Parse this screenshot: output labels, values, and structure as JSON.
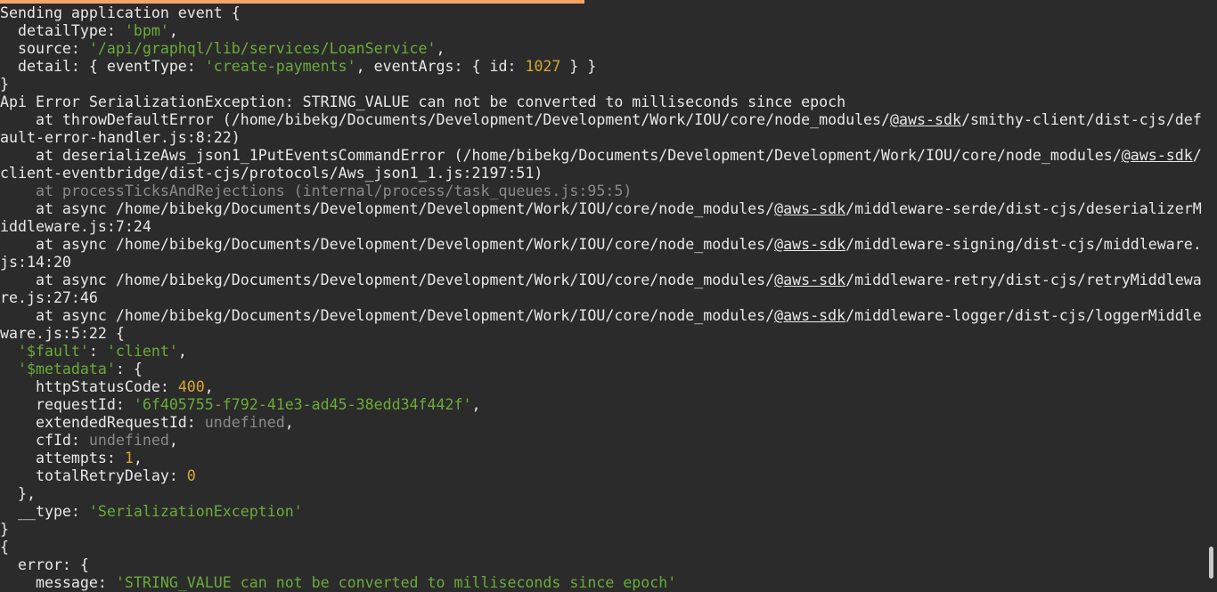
{
  "window": {
    "accent": "#f2a66a",
    "background": "#2b2b2b",
    "text": "#e8e8e8",
    "string_color": "#6aab39",
    "number_color": "#d6a92f",
    "undefined_color": "#8a8a8a"
  },
  "event": {
    "header": "Sending application event {",
    "detailType_key": "  detailType: ",
    "detailType_val": "'bpm'",
    "detailType_end": ",",
    "source_key": "  source: ",
    "source_val": "'/api/graphql/lib/services/LoanService'",
    "source_end": ",",
    "detail_pre": "  detail: { eventType: ",
    "detail_type": "'create-payments'",
    "detail_mid": ", eventArgs: { id: ",
    "detail_id": "1027",
    "detail_end": " } }",
    "close": "}"
  },
  "error": {
    "title": "Api Error SerializationException: STRING_VALUE can not be converted to milliseconds since epoch",
    "stack_link": "@aws-sdk",
    "stack": [
      {
        "pre": "    at throwDefaultError (/home/bibekg/Documents/Development/Development/Work/IOU/core/node_modules/",
        "post": "/smithy-client/dist-cjs/def",
        "cont": "ault-error-handler.js:8:22)"
      },
      {
        "pre": "    at deserializeAws_json1_1PutEventsCommandError (/home/bibekg/Documents/Development/Development/Work/IOU/core/node_modules/",
        "post": "/",
        "cont": "client-eventbridge/dist-cjs/protocols/Aws_json1_1.js:2197:51)"
      },
      {
        "dim": "    at processTicksAndRejections (internal/process/task_queues.js:95:5)"
      },
      {
        "pre": "    at async /home/bibekg/Documents/Development/Development/Work/IOU/core/node_modules/",
        "post": "/middleware-serde/dist-cjs/deserializerM",
        "cont": "iddleware.js:7:24"
      },
      {
        "pre": "    at async /home/bibekg/Documents/Development/Development/Work/IOU/core/node_modules/",
        "post": "/middleware-signing/dist-cjs/middleware.",
        "cont": "js:14:20"
      },
      {
        "pre": "    at async /home/bibekg/Documents/Development/Development/Work/IOU/core/node_modules/",
        "post": "/middleware-retry/dist-cjs/retryMiddlewa",
        "cont": "re.js:27:46"
      },
      {
        "pre": "    at async /home/bibekg/Documents/Development/Development/Work/IOU/core/node_modules/",
        "post": "/middleware-logger/dist-cjs/loggerMiddle",
        "cont": "ware.js:5:22 {"
      }
    ],
    "fault_key": "'$fault'",
    "fault_val": "'client'",
    "metadata_key": "'$metadata'",
    "httpStatusCode": "400",
    "requestId": "'6f405755-f792-41e3-ad45-38edd34f442f'",
    "extendedRequestId": "undefined",
    "cfId": "undefined",
    "attempts": "1",
    "totalRetryDelay": "0",
    "type_val": "'SerializationException'"
  },
  "labels": {
    "indent2": "  ",
    "comma": ",",
    "colon": ": ",
    "brace_open": ": {",
    "httpStatusCode": "    httpStatusCode: ",
    "requestId": "    requestId: ",
    "extendedRequestId": "    extendedRequestId: ",
    "cfId": "    cfId: ",
    "attempts": "    attempts: ",
    "totalRetryDelay": "    totalRetryDelay: ",
    "meta_close": "  },",
    "type_key": "  __type: ",
    "close": "}",
    "open": "{",
    "error_open": "  error: {",
    "message_key": "    message: ",
    "message_val": "'STRING_VALUE can not be converted to milliseconds since epoch'"
  }
}
